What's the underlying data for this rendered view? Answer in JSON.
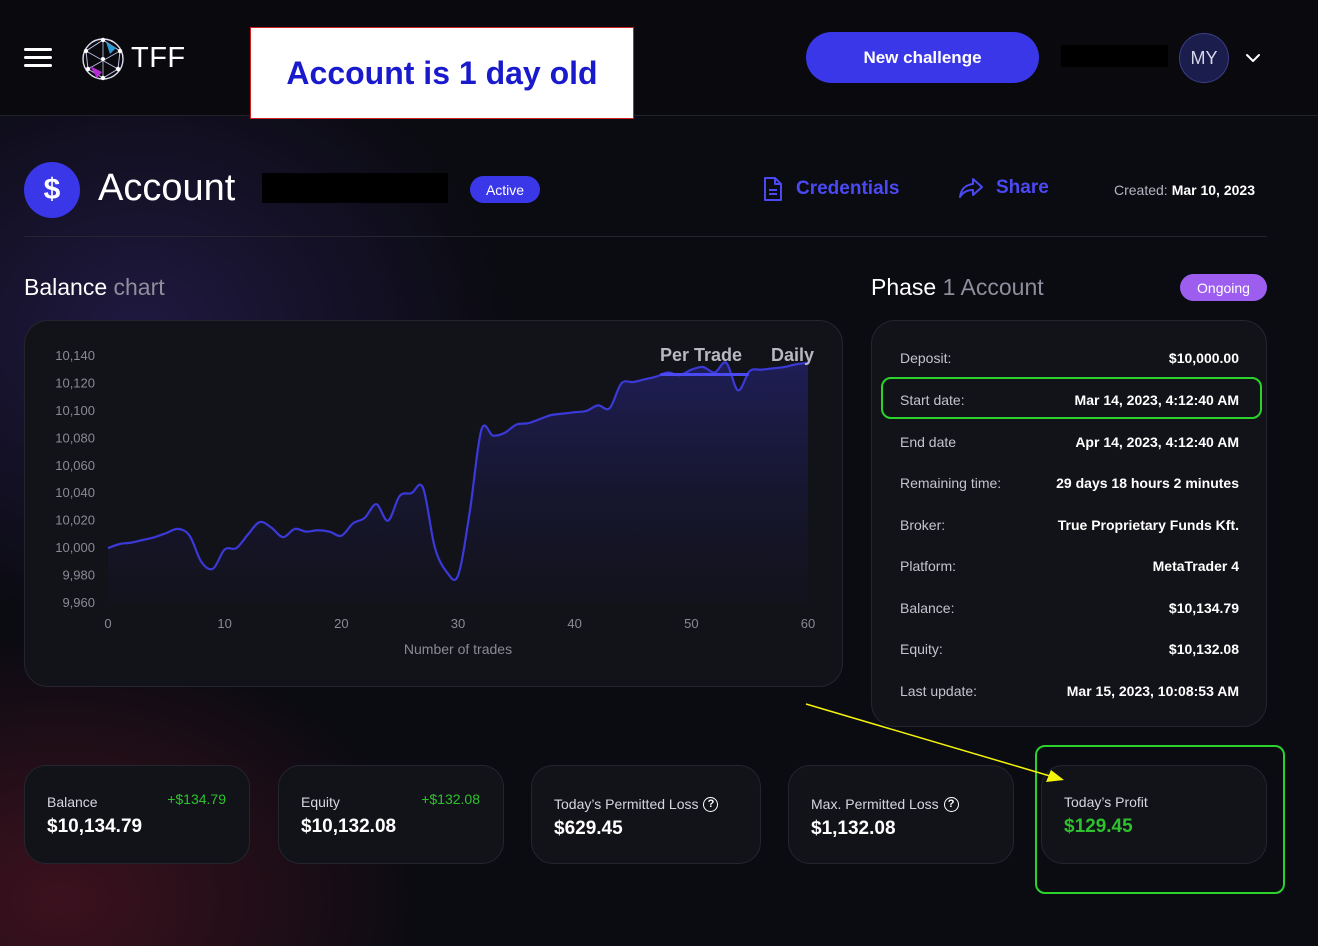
{
  "header": {
    "logo_text": "TFF",
    "annotation_note": "Account is 1 day old",
    "new_challenge_label": "New challenge",
    "user_initials": "MY"
  },
  "account": {
    "title": "Account",
    "status": "Active",
    "credentials_label": "Credentials",
    "share_label": "Share",
    "created_label": "Created:",
    "created_value": "Mar 10, 2023"
  },
  "balance_chart": {
    "title_main": "Balance",
    "title_muted": "chart",
    "tabs": [
      "Per Trade",
      "Daily"
    ],
    "active_tab": "Per Trade"
  },
  "chart_data": {
    "type": "area",
    "title": "",
    "xlabel": "Number of trades",
    "ylabel": "",
    "xlim": [
      0,
      60
    ],
    "ylim": [
      9960,
      10140
    ],
    "x_ticks": [
      0,
      10,
      20,
      30,
      40,
      50,
      60
    ],
    "y_ticks": [
      9960,
      9980,
      10000,
      10020,
      10040,
      10060,
      10080,
      10100,
      10120,
      10140
    ],
    "y_tick_labels": [
      "9,960",
      "9,980",
      "10,000",
      "10,020",
      "10,040",
      "10,060",
      "10,080",
      "10,100",
      "10,120",
      "10,140"
    ],
    "line_color": "#3b39d8",
    "grid": false,
    "series": [
      {
        "name": "",
        "x": [
          0,
          1,
          2,
          3,
          4,
          5,
          6,
          7,
          8,
          9,
          10,
          11,
          12,
          13,
          14,
          15,
          16,
          17,
          18,
          19,
          20,
          21,
          22,
          23,
          24,
          25,
          26,
          27,
          28,
          29,
          30,
          31,
          32,
          33,
          34,
          35,
          36,
          37,
          38,
          39,
          40,
          41,
          42,
          43,
          44,
          45,
          46,
          47,
          48,
          49,
          50,
          51,
          52,
          53,
          54,
          55,
          56,
          57,
          58,
          59,
          60
        ],
        "y": [
          10000,
          10003,
          10004,
          10006,
          10008,
          10011,
          10014,
          10009,
          9990,
          9985,
          9999,
          10000,
          10010,
          10019,
          10015,
          10008,
          10014,
          10012,
          10013,
          10012,
          10009,
          10018,
          10022,
          10032,
          10020,
          10038,
          10040,
          10044,
          10001,
          9983,
          9980,
          10026,
          10086,
          10082,
          10084,
          10090,
          10091,
          10094,
          10097,
          10098,
          10099,
          10100,
          10104,
          10102,
          10120,
          10121,
          10123,
          10125,
          10128,
          10126,
          10130,
          10132,
          10128,
          10135,
          10115,
          10129,
          10130,
          10131,
          10132,
          10134,
          10135
        ]
      }
    ]
  },
  "phase": {
    "title_main": "Phase",
    "title_muted": "1 Account",
    "status": "Ongoing",
    "rows": [
      {
        "label": "Deposit:",
        "value": "$10,000.00"
      },
      {
        "label": "Start date:",
        "value": "Mar 14, 2023, 4:12:40 AM"
      },
      {
        "label": "End date",
        "value": "Apr 14, 2023, 4:12:40 AM"
      },
      {
        "label": "Remaining time:",
        "value": "29 days 18 hours 2 minutes"
      },
      {
        "label": "Broker:",
        "value": "True Proprietary Funds Kft."
      },
      {
        "label": "Platform:",
        "value": "MetaTrader 4"
      },
      {
        "label": "Balance:",
        "value": "$10,134.79"
      },
      {
        "label": "Equity:",
        "value": "$10,132.08"
      },
      {
        "label": "Last update:",
        "value": "Mar 15, 2023, 10:08:53 AM"
      }
    ]
  },
  "stats": {
    "balance": {
      "label": "Balance",
      "value": "$10,134.79",
      "delta": "+$134.79"
    },
    "equity": {
      "label": "Equity",
      "value": "$10,132.08",
      "delta": "+$132.08"
    },
    "todays_permitted_loss": {
      "label": "Today’s Permitted Loss",
      "value": "$629.45"
    },
    "max_permitted_loss": {
      "label": "Max. Permitted Loss",
      "value": "$1,132.08"
    },
    "todays_profit": {
      "label": "Today’s Profit",
      "value": "$129.45"
    }
  },
  "colors": {
    "accent": "#3a37e8",
    "ongoing": "#9d5ef0",
    "profit_green": "#2ec12e",
    "highlight_green": "#2bd22b",
    "annotation_arrow": "#f4f40a"
  }
}
